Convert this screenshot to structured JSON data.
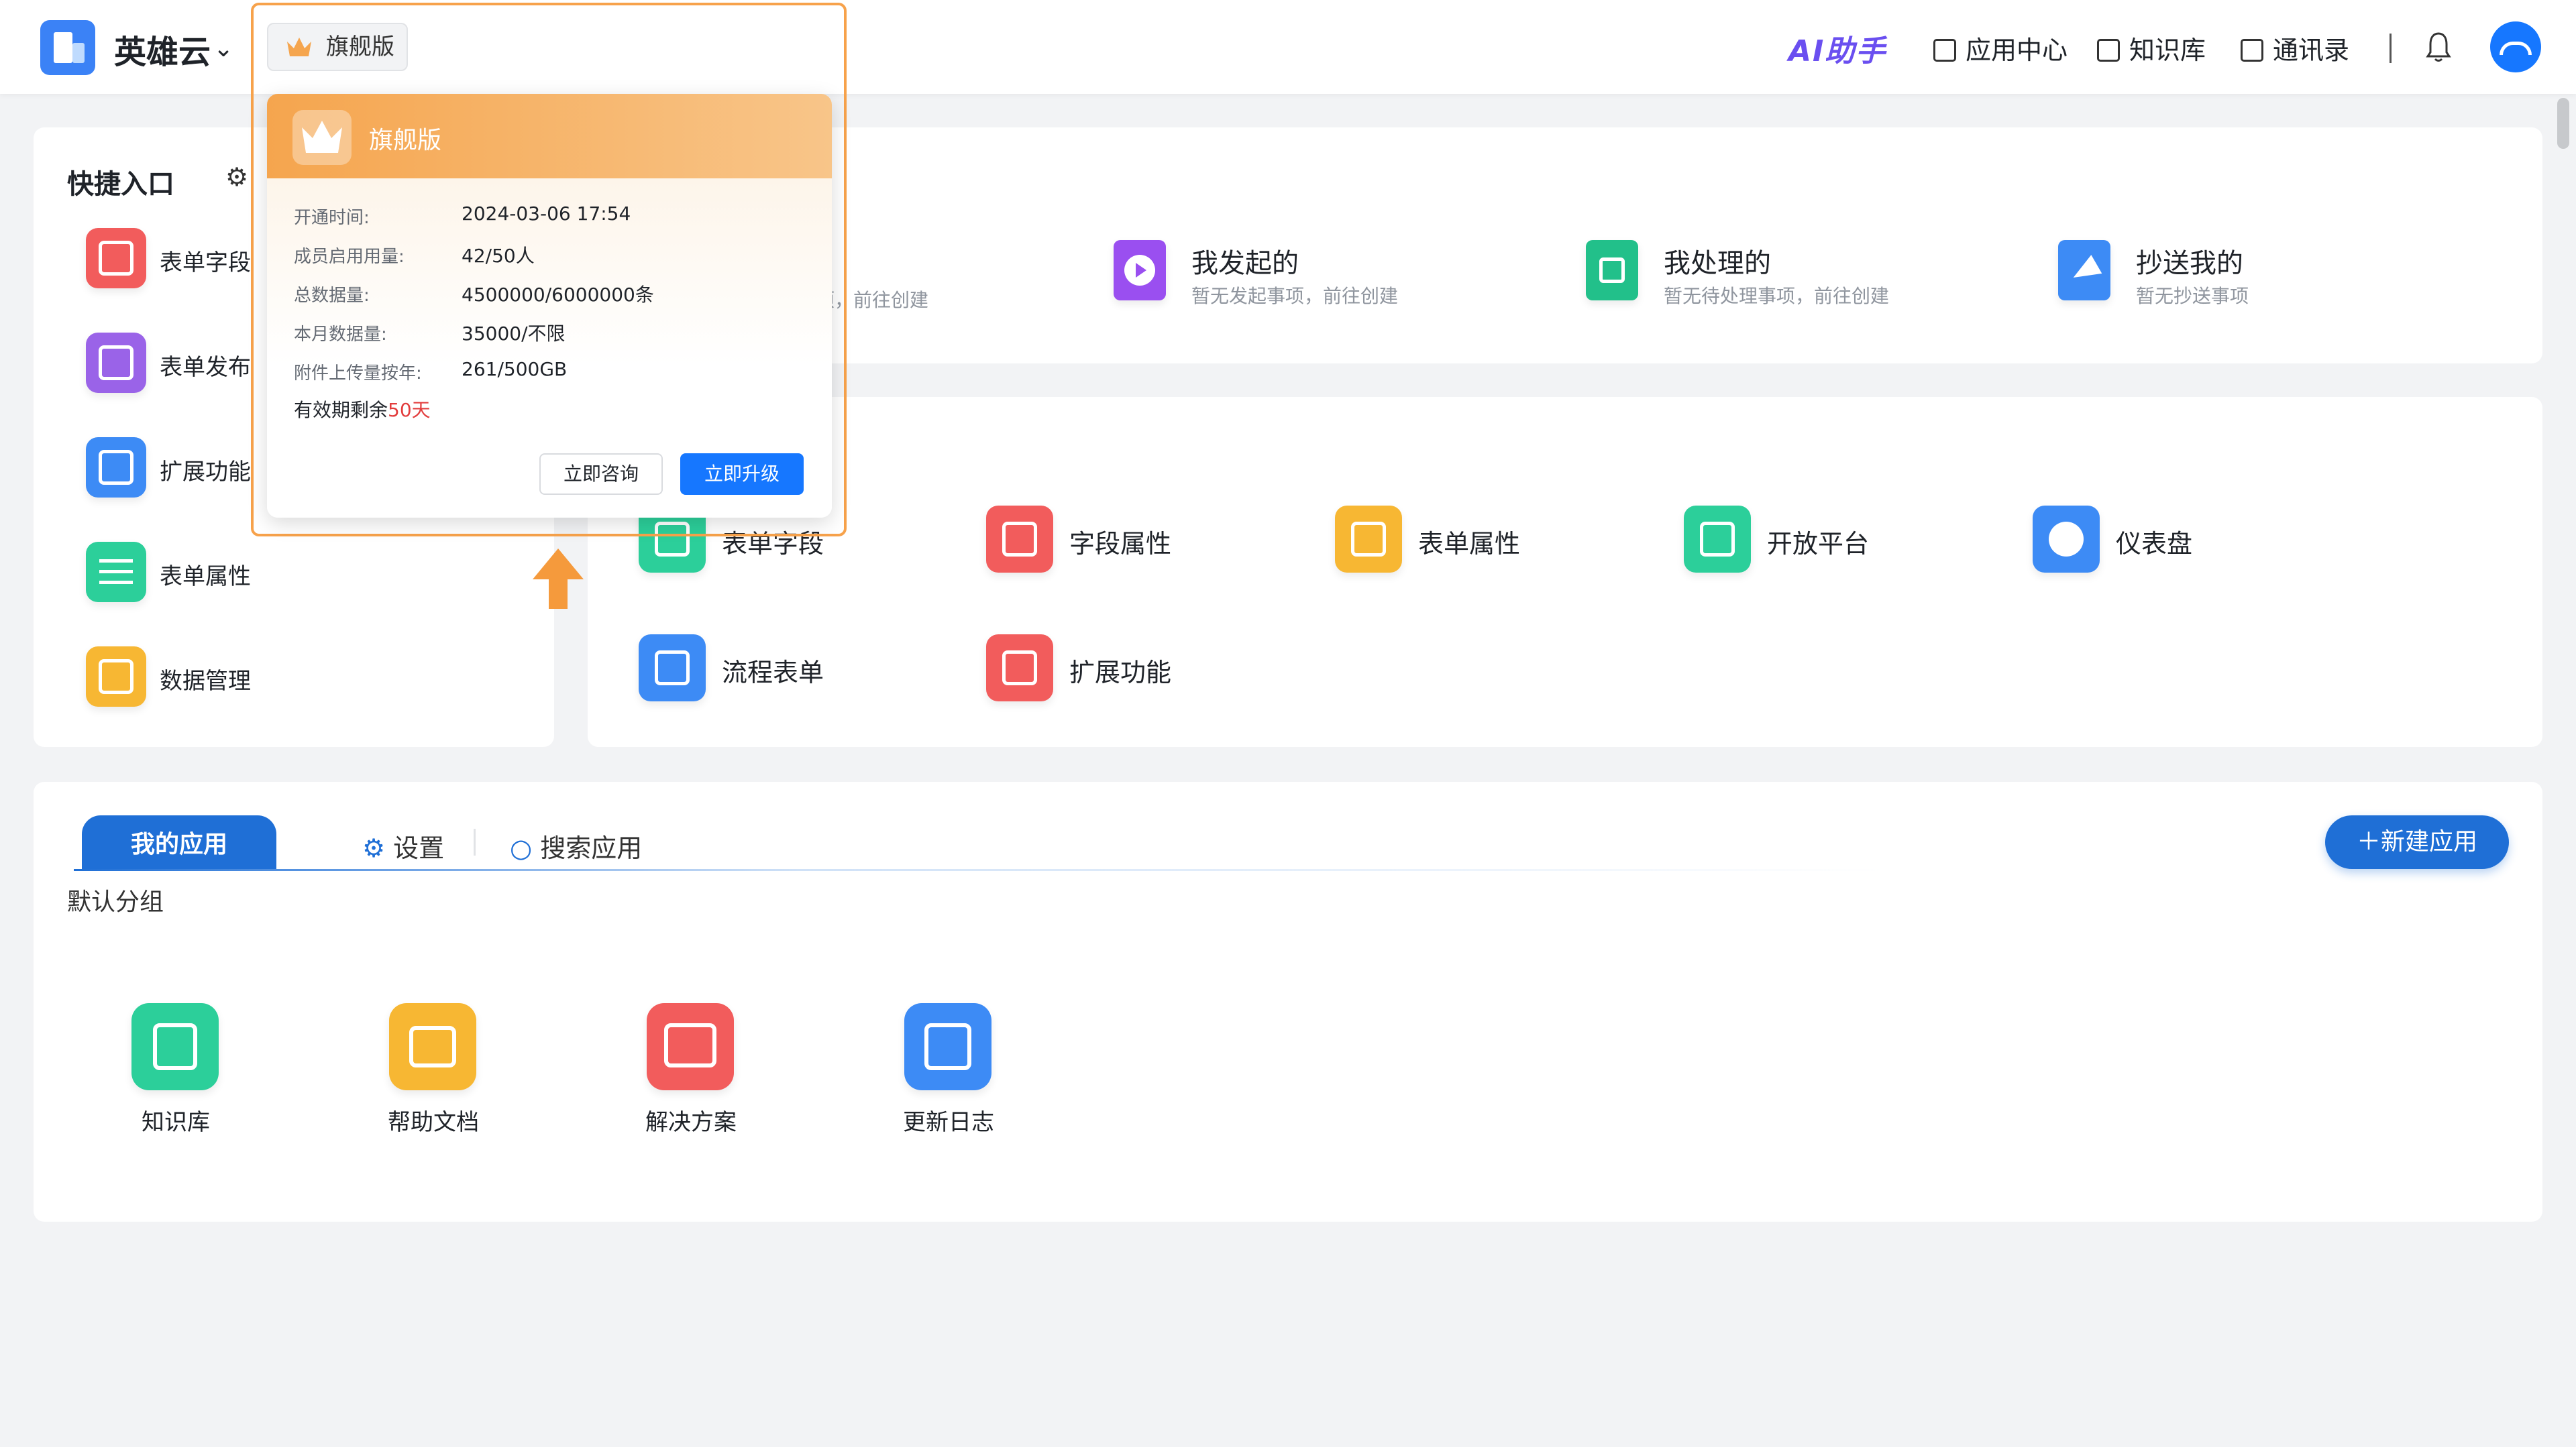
{
  "header": {
    "brand": "英雄云",
    "ai_label": "AI助手",
    "nav": [
      {
        "label": "应用中心",
        "icon": "store-icon"
      },
      {
        "label": "知识库",
        "icon": "book-icon"
      },
      {
        "label": "通讯录",
        "icon": "contacts-icon"
      }
    ]
  },
  "plan_popover": {
    "badge_label": "旗舰版",
    "title": "旗舰版",
    "rows": [
      {
        "key": "开通时间:",
        "value": "2024-03-06 17:54"
      },
      {
        "key": "成员启用用量:",
        "value": "42/50人"
      },
      {
        "key": "总数据量:",
        "value": "4500000/6000000条"
      },
      {
        "key": "本月数据量:",
        "value": "35000/不限"
      },
      {
        "key": "附件上传量按年:",
        "value": "261/500GB"
      }
    ],
    "remain_prefix": "有效期剩余",
    "remain_value": "50天",
    "consult_label": "立即咨询",
    "upgrade_label": "立即升级"
  },
  "quick_entry": {
    "title": "快捷入口",
    "items": [
      {
        "label": "表单字段",
        "color": "#f25c5c"
      },
      {
        "label": "表单发布",
        "color": "#9a63e8"
      },
      {
        "label": "扩展功能",
        "color": "#3d8bf5"
      },
      {
        "label": "表单属性",
        "color": "#2ccf9a"
      },
      {
        "label": "数据管理",
        "color": "#f7b733"
      }
    ]
  },
  "todos": [
    {
      "title": "",
      "sub": "项，前往创建"
    },
    {
      "title": "我发起的",
      "sub": "暂无发起事项，前往创建",
      "color": "#9a4ff0"
    },
    {
      "title": "我处理的",
      "sub": "暂无待处理事项，前往创建",
      "color": "#22c08a"
    },
    {
      "title": "抄送我的",
      "sub": "暂无抄送事项",
      "color": "#3d8bf5"
    }
  ],
  "functions": [
    {
      "label": "表单字段",
      "color": "#2ccf9a"
    },
    {
      "label": "字段属性",
      "color": "#f25c5c"
    },
    {
      "label": "表单属性",
      "color": "#f7b733"
    },
    {
      "label": "开放平台",
      "color": "#2ccf9a"
    },
    {
      "label": "仪表盘",
      "color": "#3d8bf5"
    },
    {
      "label": "流程表单",
      "color": "#3d8bf5"
    },
    {
      "label": "扩展功能",
      "color": "#f25c5c"
    }
  ],
  "apps_section": {
    "tab_active": "我的应用",
    "tab_settings": "设置",
    "tab_search": "搜索应用",
    "new_app": "新建应用",
    "group": "默认分组",
    "apps": [
      {
        "label": "知识库",
        "color": "#2ccf9a"
      },
      {
        "label": "帮助文档",
        "color": "#f7b733"
      },
      {
        "label": "解决方案",
        "color": "#f25c5c"
      },
      {
        "label": "更新日志",
        "color": "#3d8bf5"
      }
    ]
  }
}
